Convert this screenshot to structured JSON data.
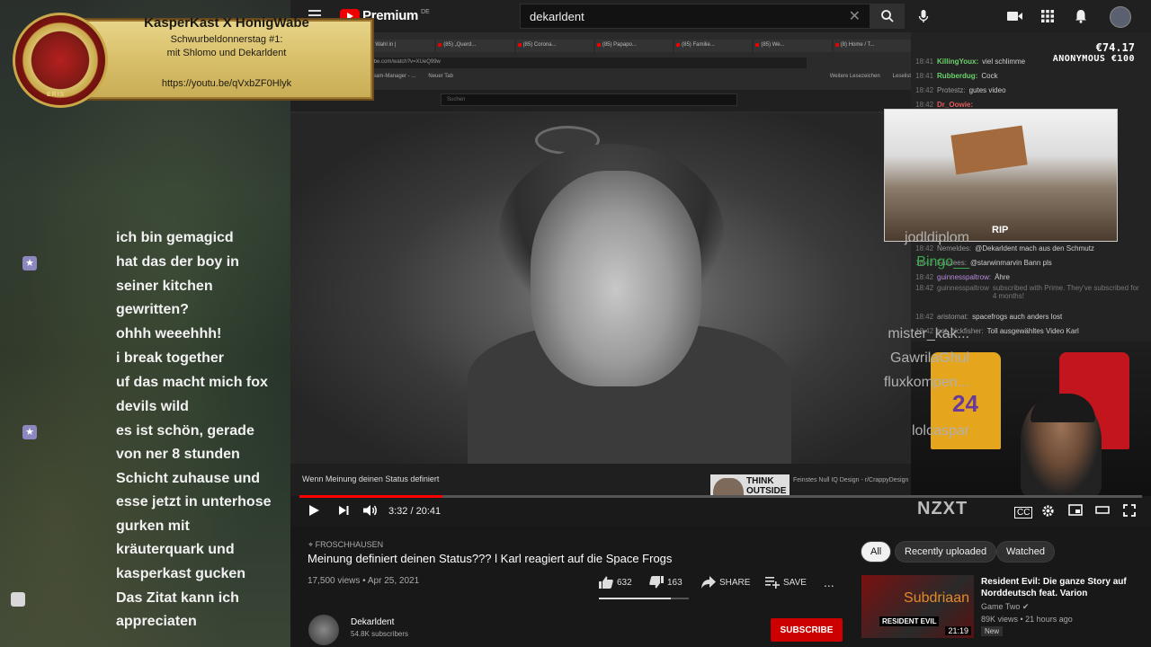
{
  "youtube": {
    "logo_text": "Premium",
    "logo_region": "DE",
    "search_value": "dekarldent"
  },
  "browser": {
    "tabs": [
      "(85) Wahl in |",
      "(85) „Querd...",
      "(85) Corona...",
      "(85) Papapo...",
      "(85) Familie...",
      "(85) We...",
      "(8) Home / T..."
    ],
    "url": "youtube.com/watch?v=XUeQ99w",
    "bookmarks": [
      "Stream-Manager - ...",
      "Neuer Tab",
      "Weitere Lesezeichen",
      "Leselist"
    ],
    "inner_search_placeholder": "Suchen"
  },
  "banner": {
    "title": "KasperKast X HonigWabe",
    "subtitle_line1": "Schwurbeldonnerstag #1:",
    "subtitle_line2": "mit Shlomo und Dekarldent",
    "url": "https://youtu.be/qVxbZF0Hlyk",
    "logo_text": "ERIS"
  },
  "left_chat": [
    {
      "user": "jodldiplom",
      "lines": [
        "ich bin gemagicd"
      ],
      "badge": "",
      "color": "grey"
    },
    {
      "user": "Bingo__",
      "lines": [
        "hat das der boy in",
        "seiner kitchen",
        "gewritten?"
      ],
      "badge": "star",
      "color": "green"
    },
    {
      "user": "mister_kak...",
      "lines": [
        "ohhh weeehhh!"
      ],
      "badge": "",
      "color": "grey"
    },
    {
      "user": "GawrilaGhul",
      "lines": [
        "i break together"
      ],
      "badge": "",
      "color": "grey"
    },
    {
      "user": "fluxkompen...",
      "lines": [
        "uf das macht mich fox",
        "devils wild"
      ],
      "badge": "",
      "color": "grey"
    },
    {
      "user": "lolcaspar",
      "lines": [
        "es ist schön, gerade",
        "von ner 8 stunden",
        "Schicht zuhause und",
        "esse jetzt in unterhose",
        "gurken mit",
        "kräuterquark und",
        "kasperkast gucken"
      ],
      "badge": "star",
      "color": "grey"
    },
    {
      "user": "Subdriaan",
      "lines": [
        "Das Zitat kann ich",
        "appreciaten"
      ],
      "badge": "plain",
      "color": "orange"
    }
  ],
  "right_chat": [
    {
      "time": "18:41",
      "user": "KillingYoux:",
      "msg": "viel schlimme"
    },
    {
      "time": "18:41",
      "user": "Rubberdug:",
      "msg": "Cock"
    },
    {
      "time": "18:42",
      "user": "Protestz:",
      "msg": "gutes video"
    },
    {
      "time": "18:42",
      "user": "Dr_Oowie:",
      "msg": ""
    }
  ],
  "right_chat_lower": [
    {
      "time": "18:42",
      "user": "Nemeldes:",
      "msg": "@Dekarldent mach aus den Schmutz"
    },
    {
      "time": "18:42",
      "user": "Fanzees:",
      "msg": "@starwinmarvin Bann pls"
    },
    {
      "time": "18:42",
      "user": "guinnesspaltrow:",
      "msg": "Ähre"
    },
    {
      "time": "18:42",
      "user": "guinnesspaltrow",
      "msg": "subscribed with Prime. They've subscribed for 4 months!"
    },
    {
      "time": "18:42",
      "user": "aristomat:",
      "msg": "spacefrogs auch anders lost"
    },
    {
      "time": "18:42",
      "user": "not_nickfisher:",
      "msg": "Toll ausgewähltes Video Karl"
    }
  ],
  "donation": {
    "amount": "€74.17",
    "donor": "ANONYMOUS €100"
  },
  "overlay_image_label": "RIP",
  "video": {
    "caption": "Wenn Meinung deinen Status definiert",
    "end_card_title": "THINK OUTSIDE THE BOX",
    "end_card_desc": "Feinstes Null IQ Design - r/CrappyDesign",
    "time": "3:32 / 20:41",
    "progress": 0.17,
    "jersey_number": "24",
    "watermark": "NZXT"
  },
  "info": {
    "location": "FROSCHHAUSEN",
    "title": "Meinung definiert deinen Status??? l Karl reagiert auf die Space Frogs",
    "meta": "17,500 views • Apr 25, 2021",
    "likes": "632",
    "dislikes": "163",
    "share": "SHARE",
    "save": "SAVE",
    "more": "..."
  },
  "channel": {
    "name": "Dekarldent",
    "subs": "54.8K subscribers",
    "subscribe": "SUBSCRIBE"
  },
  "chips": [
    "All",
    "Recently uploaded",
    "Watched"
  ],
  "recommended": {
    "title": "Resident Evil: Die ganze Story auf Norddeutsch feat. Varion",
    "channel": "Game Two",
    "meta": "89K views • 21 hours ago",
    "badge": "New",
    "duration": "21:19",
    "thumb_label": "RESIDENT EVIL"
  },
  "colors": {
    "accent": "#ff0000",
    "subscribe": "#cc0000",
    "banner_gold": "#d8bf6a"
  }
}
